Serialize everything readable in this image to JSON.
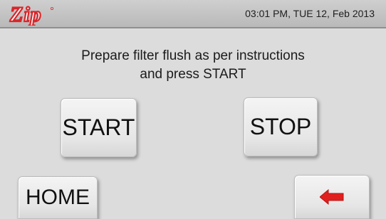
{
  "header": {
    "logo_text": "Zip",
    "datetime": "03:01 PM, TUE 12, Feb 2013"
  },
  "main": {
    "instruction_line1": "Prepare filter flush as per instructions",
    "instruction_line2": "and press START"
  },
  "buttons": {
    "start_label": "START",
    "stop_label": "STOP",
    "home_label": "HOME",
    "back_icon": "left-arrow-icon"
  },
  "colors": {
    "logo_red": "#d9262b",
    "arrow_red": "#e0201f",
    "background": "#dcdcdc"
  }
}
